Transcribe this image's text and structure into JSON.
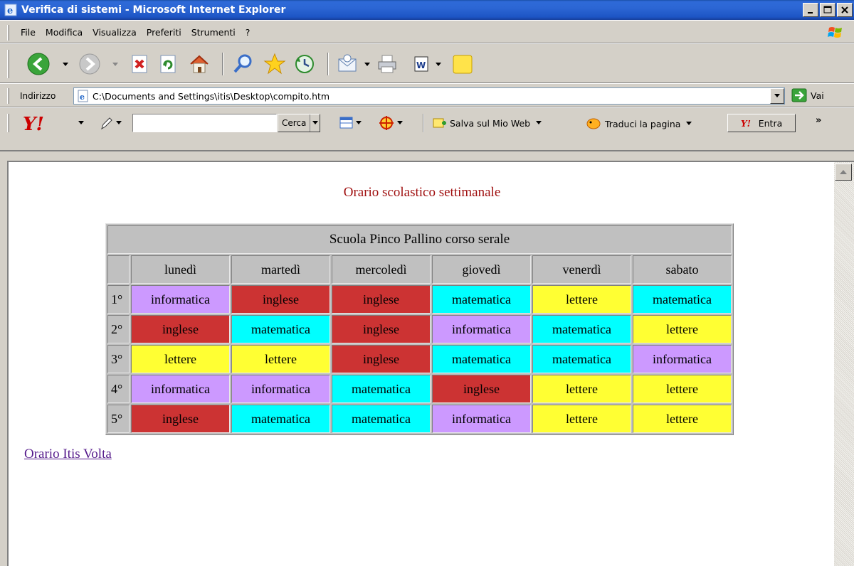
{
  "window": {
    "title": "Verifica di sistemi - Microsoft Internet Explorer"
  },
  "menu": {
    "items": [
      "File",
      "Modifica",
      "Visualizza",
      "Preferiti",
      "Strumenti",
      "?"
    ]
  },
  "address": {
    "label": "Indirizzo",
    "url": "C:\\Documents and Settings\\itis\\Desktop\\compito.htm",
    "go_label": "Vai"
  },
  "yahoo": {
    "search_value": "",
    "search_button": "Cerca",
    "save_label": "Salva sul Mio Web",
    "translate_label": "Traduci la pagina",
    "signin_label": "Entra",
    "more_label": "»"
  },
  "page": {
    "heading": "Orario scolastico settimanale",
    "link_text": "Orario Itis Volta",
    "table": {
      "caption": "Scuola Pinco Pallino corso serale",
      "days": [
        "lunedì",
        "martedì",
        "mercoledì",
        "giovedì",
        "venerdì",
        "sabato"
      ],
      "rows": [
        {
          "hour": "1°",
          "subjects": [
            "informatica",
            "inglese",
            "inglese",
            "matematica",
            "lettere",
            "matematica"
          ]
        },
        {
          "hour": "2°",
          "subjects": [
            "inglese",
            "matematica",
            "inglese",
            "informatica",
            "matematica",
            "lettere"
          ]
        },
        {
          "hour": "3°",
          "subjects": [
            "lettere",
            "lettere",
            "inglese",
            "matematica",
            "matematica",
            "informatica"
          ]
        },
        {
          "hour": "4°",
          "subjects": [
            "informatica",
            "informatica",
            "matematica",
            "inglese",
            "lettere",
            "lettere"
          ]
        },
        {
          "hour": "5°",
          "subjects": [
            "inglese",
            "matematica",
            "matematica",
            "informatica",
            "lettere",
            "lettere"
          ]
        }
      ],
      "subject_colors": {
        "informatica": "#cc99ff",
        "inglese": "#cc3333",
        "matematica": "#00ffff",
        "lettere": "#ffff33"
      }
    }
  },
  "colors": {
    "titlebar": "#2c66d4",
    "heading": "#a01010",
    "link": "#551a8b",
    "chrome": "#d4d0c8"
  }
}
